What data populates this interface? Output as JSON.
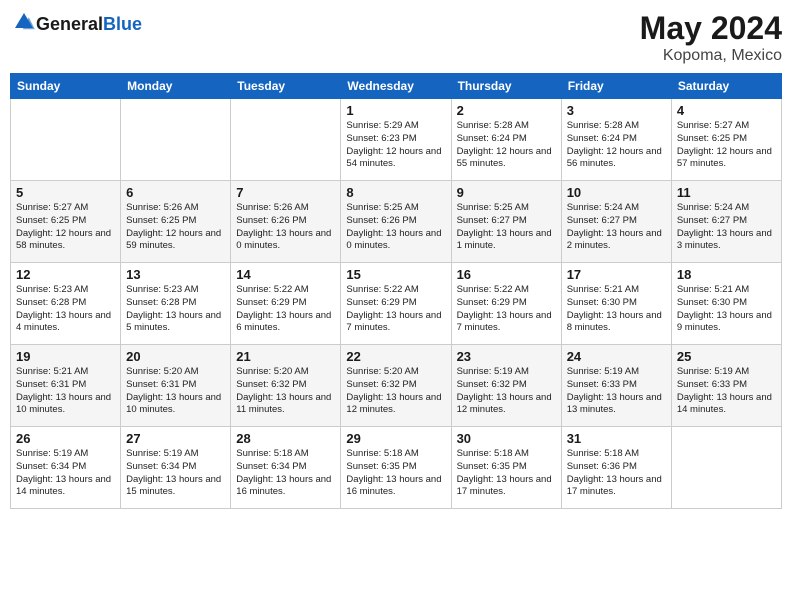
{
  "header": {
    "logo_general": "General",
    "logo_blue": "Blue",
    "month": "May 2024",
    "location": "Kopoma, Mexico"
  },
  "weekdays": [
    "Sunday",
    "Monday",
    "Tuesday",
    "Wednesday",
    "Thursday",
    "Friday",
    "Saturday"
  ],
  "weeks": [
    [
      {
        "day": "",
        "info": ""
      },
      {
        "day": "",
        "info": ""
      },
      {
        "day": "",
        "info": ""
      },
      {
        "day": "1",
        "info": "Sunrise: 5:29 AM\nSunset: 6:23 PM\nDaylight: 12 hours\nand 54 minutes."
      },
      {
        "day": "2",
        "info": "Sunrise: 5:28 AM\nSunset: 6:24 PM\nDaylight: 12 hours\nand 55 minutes."
      },
      {
        "day": "3",
        "info": "Sunrise: 5:28 AM\nSunset: 6:24 PM\nDaylight: 12 hours\nand 56 minutes."
      },
      {
        "day": "4",
        "info": "Sunrise: 5:27 AM\nSunset: 6:25 PM\nDaylight: 12 hours\nand 57 minutes."
      }
    ],
    [
      {
        "day": "5",
        "info": "Sunrise: 5:27 AM\nSunset: 6:25 PM\nDaylight: 12 hours\nand 58 minutes."
      },
      {
        "day": "6",
        "info": "Sunrise: 5:26 AM\nSunset: 6:25 PM\nDaylight: 12 hours\nand 59 minutes."
      },
      {
        "day": "7",
        "info": "Sunrise: 5:26 AM\nSunset: 6:26 PM\nDaylight: 13 hours\nand 0 minutes."
      },
      {
        "day": "8",
        "info": "Sunrise: 5:25 AM\nSunset: 6:26 PM\nDaylight: 13 hours\nand 0 minutes."
      },
      {
        "day": "9",
        "info": "Sunrise: 5:25 AM\nSunset: 6:27 PM\nDaylight: 13 hours\nand 1 minute."
      },
      {
        "day": "10",
        "info": "Sunrise: 5:24 AM\nSunset: 6:27 PM\nDaylight: 13 hours\nand 2 minutes."
      },
      {
        "day": "11",
        "info": "Sunrise: 5:24 AM\nSunset: 6:27 PM\nDaylight: 13 hours\nand 3 minutes."
      }
    ],
    [
      {
        "day": "12",
        "info": "Sunrise: 5:23 AM\nSunset: 6:28 PM\nDaylight: 13 hours\nand 4 minutes."
      },
      {
        "day": "13",
        "info": "Sunrise: 5:23 AM\nSunset: 6:28 PM\nDaylight: 13 hours\nand 5 minutes."
      },
      {
        "day": "14",
        "info": "Sunrise: 5:22 AM\nSunset: 6:29 PM\nDaylight: 13 hours\nand 6 minutes."
      },
      {
        "day": "15",
        "info": "Sunrise: 5:22 AM\nSunset: 6:29 PM\nDaylight: 13 hours\nand 7 minutes."
      },
      {
        "day": "16",
        "info": "Sunrise: 5:22 AM\nSunset: 6:29 PM\nDaylight: 13 hours\nand 7 minutes."
      },
      {
        "day": "17",
        "info": "Sunrise: 5:21 AM\nSunset: 6:30 PM\nDaylight: 13 hours\nand 8 minutes."
      },
      {
        "day": "18",
        "info": "Sunrise: 5:21 AM\nSunset: 6:30 PM\nDaylight: 13 hours\nand 9 minutes."
      }
    ],
    [
      {
        "day": "19",
        "info": "Sunrise: 5:21 AM\nSunset: 6:31 PM\nDaylight: 13 hours\nand 10 minutes."
      },
      {
        "day": "20",
        "info": "Sunrise: 5:20 AM\nSunset: 6:31 PM\nDaylight: 13 hours\nand 10 minutes."
      },
      {
        "day": "21",
        "info": "Sunrise: 5:20 AM\nSunset: 6:32 PM\nDaylight: 13 hours\nand 11 minutes."
      },
      {
        "day": "22",
        "info": "Sunrise: 5:20 AM\nSunset: 6:32 PM\nDaylight: 13 hours\nand 12 minutes."
      },
      {
        "day": "23",
        "info": "Sunrise: 5:19 AM\nSunset: 6:32 PM\nDaylight: 13 hours\nand 12 minutes."
      },
      {
        "day": "24",
        "info": "Sunrise: 5:19 AM\nSunset: 6:33 PM\nDaylight: 13 hours\nand 13 minutes."
      },
      {
        "day": "25",
        "info": "Sunrise: 5:19 AM\nSunset: 6:33 PM\nDaylight: 13 hours\nand 14 minutes."
      }
    ],
    [
      {
        "day": "26",
        "info": "Sunrise: 5:19 AM\nSunset: 6:34 PM\nDaylight: 13 hours\nand 14 minutes."
      },
      {
        "day": "27",
        "info": "Sunrise: 5:19 AM\nSunset: 6:34 PM\nDaylight: 13 hours\nand 15 minutes."
      },
      {
        "day": "28",
        "info": "Sunrise: 5:18 AM\nSunset: 6:34 PM\nDaylight: 13 hours\nand 16 minutes."
      },
      {
        "day": "29",
        "info": "Sunrise: 5:18 AM\nSunset: 6:35 PM\nDaylight: 13 hours\nand 16 minutes."
      },
      {
        "day": "30",
        "info": "Sunrise: 5:18 AM\nSunset: 6:35 PM\nDaylight: 13 hours\nand 17 minutes."
      },
      {
        "day": "31",
        "info": "Sunrise: 5:18 AM\nSunset: 6:36 PM\nDaylight: 13 hours\nand 17 minutes."
      },
      {
        "day": "",
        "info": ""
      }
    ]
  ]
}
